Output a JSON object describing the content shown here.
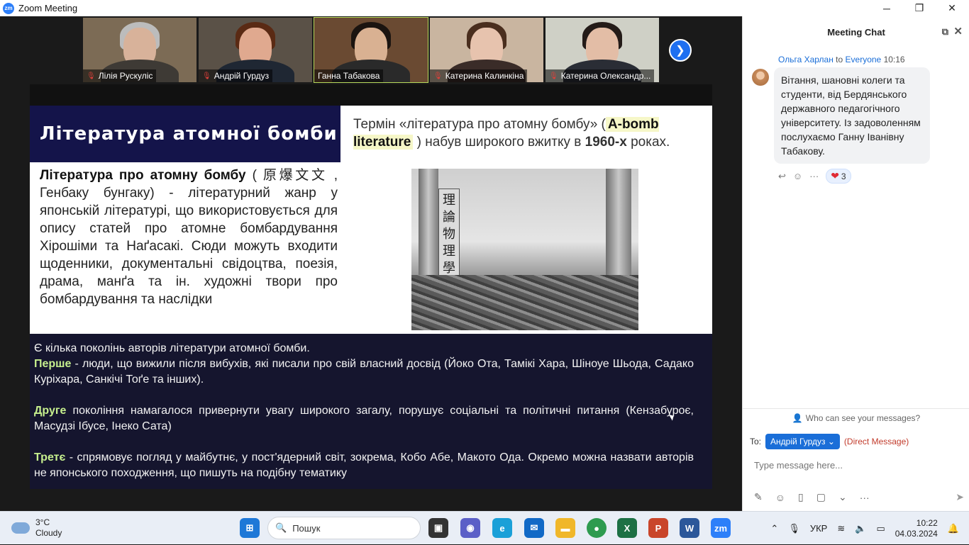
{
  "window": {
    "title": "Zoom Meeting",
    "logo": "zm"
  },
  "participants": [
    {
      "name": "Лілія Рускуліс",
      "muted": true,
      "active": false
    },
    {
      "name": "Андрій Гурдуз",
      "muted": true,
      "active": false
    },
    {
      "name": "Ганна Табакова",
      "muted": false,
      "active": true
    },
    {
      "name": "Катерина Калинкіна",
      "muted": true,
      "active": false
    },
    {
      "name": "Катерина Олександр...",
      "muted": true,
      "active": false
    }
  ],
  "slide": {
    "title": "Література атомної бомби",
    "definition_term": "Література про атомну бомбу",
    "definition_rest": " ( 原爆文文 , Генбаку бунгаку) - літературний жанр у японській літературі, що використовується для опису статей про атомне бомбардування Хірошіми та Наґасакі. Сюди можуть входити щоденники, документальні свідоцтва, поезія, драма, манґа та ін. художні твори про бомбардування та наслідки",
    "term_before": "Термін «література про атомну бомбу» (",
    "term_highlight": "A-bomb literature",
    "term_after": " ) набув широкого вжитку в ",
    "term_decade": "1960-х",
    "term_end": " роках.",
    "photo_sign": "理論物理學研究所",
    "intro": "Є кілька поколінь авторів літератури атомної бомби.",
    "gen1_label": "Перше",
    "gen1_text": " - люди, що вижили після вибухів, які писали про свій власний досвід (Йоко Ота, Тамікі Хара, Шіноуе Шьода, Садако Куріхара, Санкічі Тоґе та інших).",
    "gen2_label": "Друге",
    "gen2_text": " покоління намагалося привернути увагу широкого загалу, порушує соціальні та політичні питання (Кензабуроє, Масудзі Ібусе, Інеко Сата)",
    "gen3_label": "Третє",
    "gen3_text": " - спрямовує погляд у майбутнє, у пост'ядерний світ, зокрема, Кобо Абе, Макото Ода. Окремо можна назвати авторів не японського походження, що пишуть на подібну тематику"
  },
  "chat": {
    "title": "Meeting Chat",
    "sender": "Ольга Харлан",
    "to_word": "to",
    "recipient": "Everyone",
    "time": "10:16",
    "message": "Вітання, шановні колеги та студенти, від Бердянського державного педагогічного університету. Із задоволенням послухаємо Ганну Іванівну Табакову.",
    "reaction_count": "3",
    "who_can_see": "Who can see your messages?",
    "to_label": "To:",
    "to_value": "Андрій Гурдуз",
    "direct_message": "(Direct Message)",
    "input_placeholder": "Type message here..."
  },
  "taskbar": {
    "temp": "3°C",
    "condition": "Cloudy",
    "search_placeholder": "Пошук",
    "lang": "УКР",
    "time": "10:22",
    "date": "04.03.2024"
  }
}
